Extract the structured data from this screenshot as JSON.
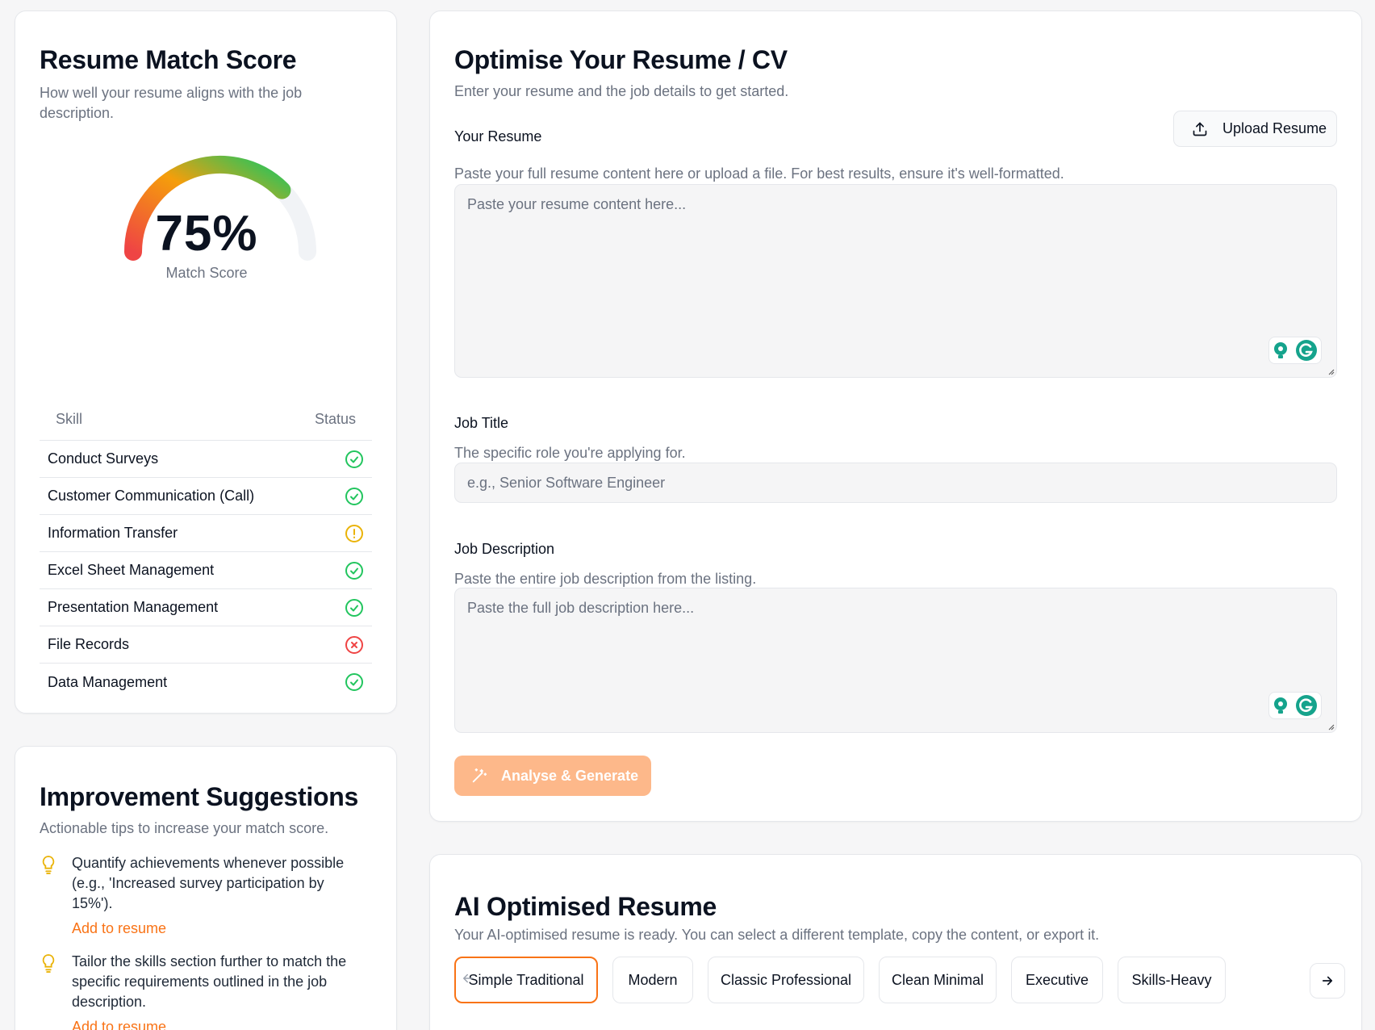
{
  "score_card": {
    "title": "Resume Match Score",
    "subtitle": "How well your resume aligns with the job description.",
    "score_value": "75%",
    "score_fraction": 0.75,
    "score_caption": "Match Score",
    "table_headers": {
      "skill": "Skill",
      "status": "Status"
    },
    "skills": [
      {
        "name": "Conduct Surveys",
        "status": "matched"
      },
      {
        "name": "Customer Communication (Call)",
        "status": "matched"
      },
      {
        "name": "Information Transfer",
        "status": "partial"
      },
      {
        "name": "Excel Sheet Management",
        "status": "matched"
      },
      {
        "name": "Presentation Management",
        "status": "matched"
      },
      {
        "name": "File Records",
        "status": "missing"
      },
      {
        "name": "Data Management",
        "status": "matched"
      }
    ],
    "colors": {
      "matched": "#22c55e",
      "partial": "#eab308",
      "missing": "#ef4444"
    }
  },
  "suggestions_card": {
    "title": "Improvement Suggestions",
    "subtitle": "Actionable tips to increase your match score.",
    "items": [
      {
        "text": "Quantify achievements whenever possible (e.g., 'Increased survey participation by 15%').",
        "action": "Add to resume"
      },
      {
        "text": "Tailor the skills section further to match the specific requirements outlined in the job description.",
        "action": "Add to resume"
      }
    ]
  },
  "form_card": {
    "title": "Optimise Your Resume / CV",
    "subtitle": "Enter your resume and the job details to get started.",
    "resume_label": "Your Resume",
    "upload_label": "Upload Resume",
    "resume_help": "Paste your full resume content here or upload a file. For best results, ensure it's well-formatted.",
    "resume_placeholder": "Paste your resume content here...",
    "job_title_label": "Job Title",
    "job_title_help": "The specific role you're applying for.",
    "job_title_placeholder": "e.g., Senior Software Engineer",
    "job_desc_label": "Job Description",
    "job_desc_help": "Paste the entire job description from the listing.",
    "job_desc_placeholder": "Paste the full job description here...",
    "analyse_label": "Analyse & Generate"
  },
  "output_card": {
    "title": "AI Optimised Resume",
    "subtitle": "Your AI-optimised resume is ready. You can select a different template, copy the content, or export it.",
    "templates": [
      "Simple Traditional",
      "Modern",
      "Classic Professional",
      "Clean Minimal",
      "Executive",
      "Skills-Heavy"
    ],
    "active_template": "Simple Traditional"
  },
  "theme": {
    "accent": "#f97316",
    "accent_disabled": "#fdb88a"
  }
}
